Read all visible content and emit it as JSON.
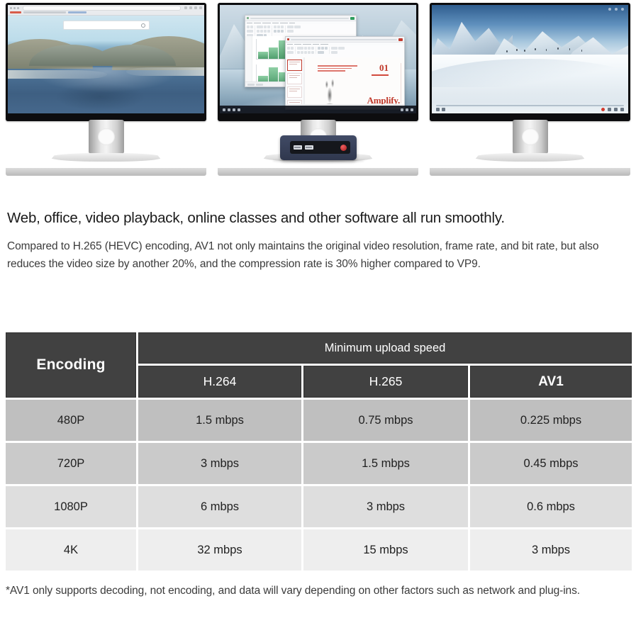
{
  "hero": {
    "monitors": [
      {
        "id": "left-monitor",
        "screen_content": "web-browser",
        "description": "Desktop monitor displaying a web browser with a lake and hills wallpaper and a centered search box",
        "browser": {
          "search_placeholder": ""
        }
      },
      {
        "id": "center-monitor",
        "screen_content": "office-suite",
        "description": "Desktop monitor displaying spreadsheet and presentation windows over a glacier wallpaper, with a mini PC on the stand",
        "slide": {
          "number": "01",
          "wordmark": "Amplify."
        }
      },
      {
        "id": "right-monitor",
        "screen_content": "video-playback",
        "description": "Desktop monitor playing a snowy mountain video with playback controls"
      }
    ]
  },
  "copy": {
    "headline": "Web, office, video playback, online classes and other software all run smoothly.",
    "paragraph": "Compared to H.265 (HEVC) encoding, AV1 not only maintains the original video resolution, frame rate, and bit rate, but also reduces the video size by another 20%, and the compression rate is 30% higher compared to VP9."
  },
  "table": {
    "row_header_label": "Encoding",
    "group_header_label": "Minimum upload speed",
    "codec_columns": [
      "H.264",
      "H.265",
      "AV1"
    ],
    "accent_column": "AV1",
    "rows": [
      {
        "encoding": "480P",
        "h264": "1.5 mbps",
        "h265": "0.75 mbps",
        "av1": "0.225 mbps"
      },
      {
        "encoding": "720P",
        "h264": "3 mbps",
        "h265": "1.5 mbps",
        "av1": "0.45 mbps"
      },
      {
        "encoding": "1080P",
        "h264": "6 mbps",
        "h265": "3 mbps",
        "av1": "0.6 mbps"
      },
      {
        "encoding": "4K",
        "h264": "32 mbps",
        "h265": "15 mbps",
        "av1": "3 mbps"
      }
    ]
  },
  "footnote": "*AV1 only supports decoding, not encoding, and data will vary depending on other factors such as network and plug-ins.",
  "colors": {
    "header_dark": "#414141",
    "row_1": "#bfbfbf",
    "row_2": "#cacaca",
    "row_3": "#dedede",
    "row_4": "#eeeeee",
    "headline_text": "#1a1a1a",
    "body_text": "#3b3b3b",
    "accent_red": "#c0392b",
    "minipc_navy": "#3a4258"
  }
}
